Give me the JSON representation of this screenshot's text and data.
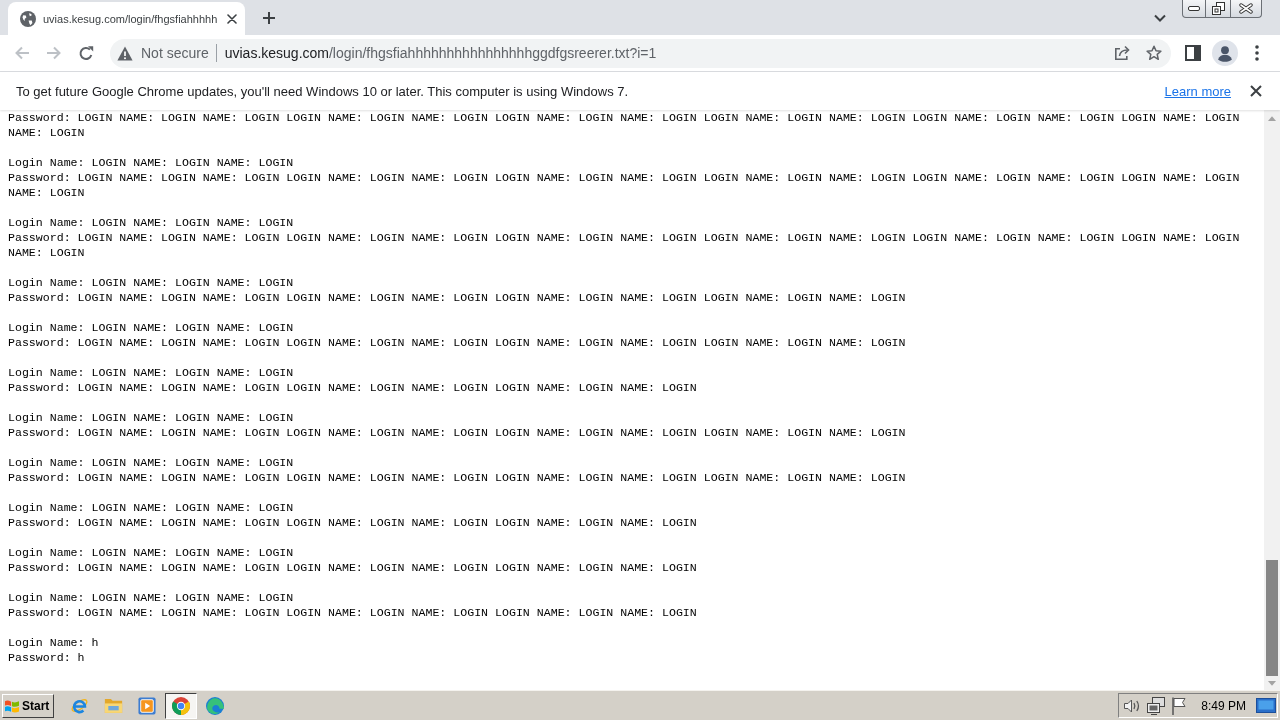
{
  "tabs": [
    {
      "title": "uvias.kesug.com/login/fhgsfiahhhhh",
      "selected": true
    }
  ],
  "toolbar": {
    "nav_buttons": [
      {
        "kind": "back",
        "disabled": true
      },
      {
        "kind": "forward",
        "disabled": true
      },
      {
        "kind": "reload",
        "disabled": false
      }
    ],
    "address_bar": {
      "security_label": "Not secure",
      "host": "uvias.kesug.com",
      "path": "/login/fhgsfiahhhhhhhhhhhhhhhhggdfgsreerer.txt?i=1"
    }
  },
  "infobar": {
    "message": "To get future Google Chrome updates, you'll need Windows 10 or later. This computer is using Windows 7.",
    "link": "Learn more"
  },
  "document": {
    "records": [
      {
        "password": "Password: LOGIN NAME: LOGIN NAME: LOGIN LOGIN NAME: LOGIN NAME: LOGIN LOGIN NAME: LOGIN NAME: LOGIN LOGIN NAME: LOGIN NAME: LOGIN LOGIN NAME: LOGIN NAME: LOGIN LOGIN NAME: LOGIN NAME: LOGIN"
      },
      {
        "login": "Login Name: LOGIN NAME: LOGIN NAME: LOGIN",
        "password": "Password: LOGIN NAME: LOGIN NAME: LOGIN LOGIN NAME: LOGIN NAME: LOGIN LOGIN NAME: LOGIN NAME: LOGIN LOGIN NAME: LOGIN NAME: LOGIN LOGIN NAME: LOGIN NAME: LOGIN LOGIN NAME: LOGIN NAME: LOGIN"
      },
      {
        "login": "Login Name: LOGIN NAME: LOGIN NAME: LOGIN",
        "password": "Password: LOGIN NAME: LOGIN NAME: LOGIN LOGIN NAME: LOGIN NAME: LOGIN LOGIN NAME: LOGIN NAME: LOGIN LOGIN NAME: LOGIN NAME: LOGIN LOGIN NAME: LOGIN NAME: LOGIN LOGIN NAME: LOGIN NAME: LOGIN"
      },
      {
        "login": "Login Name: LOGIN NAME: LOGIN NAME: LOGIN",
        "password": "Password: LOGIN NAME: LOGIN NAME: LOGIN LOGIN NAME: LOGIN NAME: LOGIN LOGIN NAME: LOGIN NAME: LOGIN LOGIN NAME: LOGIN NAME: LOGIN"
      },
      {
        "login": "Login Name: LOGIN NAME: LOGIN NAME: LOGIN",
        "password": "Password: LOGIN NAME: LOGIN NAME: LOGIN LOGIN NAME: LOGIN NAME: LOGIN LOGIN NAME: LOGIN NAME: LOGIN LOGIN NAME: LOGIN NAME: LOGIN"
      },
      {
        "login": "Login Name: LOGIN NAME: LOGIN NAME: LOGIN",
        "password": "Password: LOGIN NAME: LOGIN NAME: LOGIN LOGIN NAME: LOGIN NAME: LOGIN LOGIN NAME: LOGIN NAME: LOGIN"
      },
      {
        "login": "Login Name: LOGIN NAME: LOGIN NAME: LOGIN",
        "password": "Password: LOGIN NAME: LOGIN NAME: LOGIN LOGIN NAME: LOGIN NAME: LOGIN LOGIN NAME: LOGIN NAME: LOGIN LOGIN NAME: LOGIN NAME: LOGIN"
      },
      {
        "login": "Login Name: LOGIN NAME: LOGIN NAME: LOGIN",
        "password": "Password: LOGIN NAME: LOGIN NAME: LOGIN LOGIN NAME: LOGIN NAME: LOGIN LOGIN NAME: LOGIN NAME: LOGIN LOGIN NAME: LOGIN NAME: LOGIN"
      },
      {
        "login": "Login Name: LOGIN NAME: LOGIN NAME: LOGIN",
        "password": "Password: LOGIN NAME: LOGIN NAME: LOGIN LOGIN NAME: LOGIN NAME: LOGIN LOGIN NAME: LOGIN NAME: LOGIN"
      },
      {
        "login": "Login Name: LOGIN NAME: LOGIN NAME: LOGIN",
        "password": "Password: LOGIN NAME: LOGIN NAME: LOGIN LOGIN NAME: LOGIN NAME: LOGIN LOGIN NAME: LOGIN NAME: LOGIN"
      },
      {
        "login": "Login Name: LOGIN NAME: LOGIN NAME: LOGIN",
        "password": "Password: LOGIN NAME: LOGIN NAME: LOGIN LOGIN NAME: LOGIN NAME: LOGIN LOGIN NAME: LOGIN NAME: LOGIN"
      },
      {
        "login": "Login Name: h",
        "password": "Password: h"
      }
    ]
  },
  "taskbar": {
    "start_label": "Start",
    "apps": [
      {
        "kind": "ie",
        "selected": false
      },
      {
        "kind": "explorer",
        "selected": false
      },
      {
        "kind": "media",
        "selected": false
      },
      {
        "kind": "chrome",
        "selected": true
      },
      {
        "kind": "edge",
        "selected": false
      }
    ],
    "clock": "8:49 PM"
  }
}
